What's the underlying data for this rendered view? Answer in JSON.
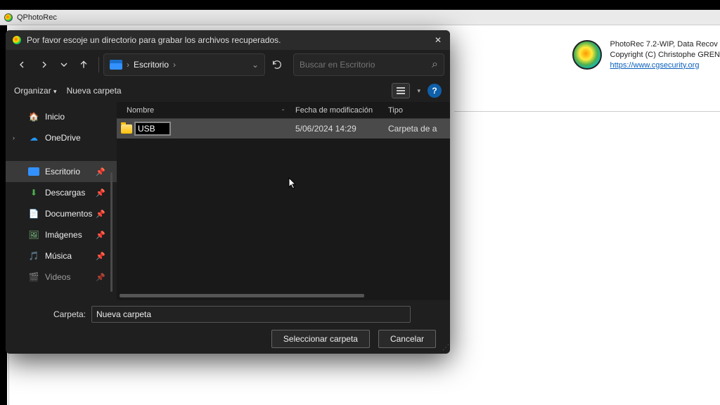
{
  "app": {
    "title": "QPhotoRec"
  },
  "qpr_info": {
    "line1": "PhotoRec 7.2-WIP, Data Recov",
    "line2": "Copyright (C) Christophe GREN",
    "link": "https://www.cgsecurity.org"
  },
  "dialog": {
    "title": "Por favor escoje un directorio para grabar los archivos recuperados.",
    "crumb_segment": "Escritorio",
    "crumb_sep1": "›",
    "crumb_sep2": "›",
    "search_placeholder": "Buscar en Escritorio",
    "organize": "Organizar",
    "organize_caret": "▾",
    "new_folder_btn": "Nueva carpeta"
  },
  "nav": {
    "home": "Inicio",
    "onedrive": "OneDrive",
    "desktop": "Escritorio",
    "downloads": "Descargas",
    "documents": "Documentos",
    "images": "Imágenes",
    "music": "Música",
    "videos": "Videos"
  },
  "columns": {
    "name": "Nombre",
    "date": "Fecha de modificación",
    "type": "Tipo"
  },
  "rows": [
    {
      "name": "USB",
      "date": "5/06/2024 14:29",
      "type": "Carpeta de a"
    }
  ],
  "footer": {
    "label": "Carpeta:",
    "value": "Nueva carpeta",
    "select": "Seleccionar carpeta",
    "cancel": "Cancelar"
  },
  "icons": {
    "home_glyph": "🏠",
    "cloud_glyph": "☁",
    "desktop_glyph": "🖥",
    "download_glyph": "⬇",
    "doc_glyph": "📄",
    "image_glyph": "🖼",
    "music_glyph": "🎵",
    "video_glyph": "🎬",
    "pin_glyph": "📌",
    "help_glyph": "?",
    "close_glyph": "✕",
    "chevron_down": "⌄",
    "chevron_right": "›",
    "sort_up": "⌃",
    "search_glyph": "⌕",
    "caret": "▾"
  }
}
